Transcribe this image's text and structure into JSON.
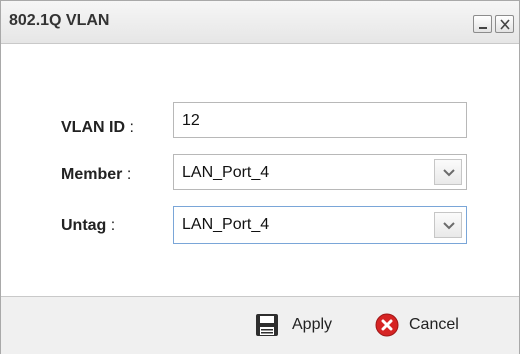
{
  "dialog": {
    "title": "802.1Q VLAN"
  },
  "form": {
    "vlan_id_label": "VLAN ID",
    "vlan_id_value": "12",
    "member_label": "Member",
    "member_value": "LAN_Port_4",
    "untag_label": "Untag",
    "untag_value": "LAN_Port_4",
    "colon": ":"
  },
  "footer": {
    "apply_label": "Apply",
    "cancel_label": "Cancel"
  },
  "icons": {
    "minimize": "minimize-icon",
    "close": "close-icon",
    "dropdown": "chevron-down-icon",
    "apply": "floppy-disk-icon",
    "cancel": "cancel-x-icon"
  },
  "colors": {
    "cancel_icon": "#d62424",
    "focus_border": "#7aa6d8"
  }
}
